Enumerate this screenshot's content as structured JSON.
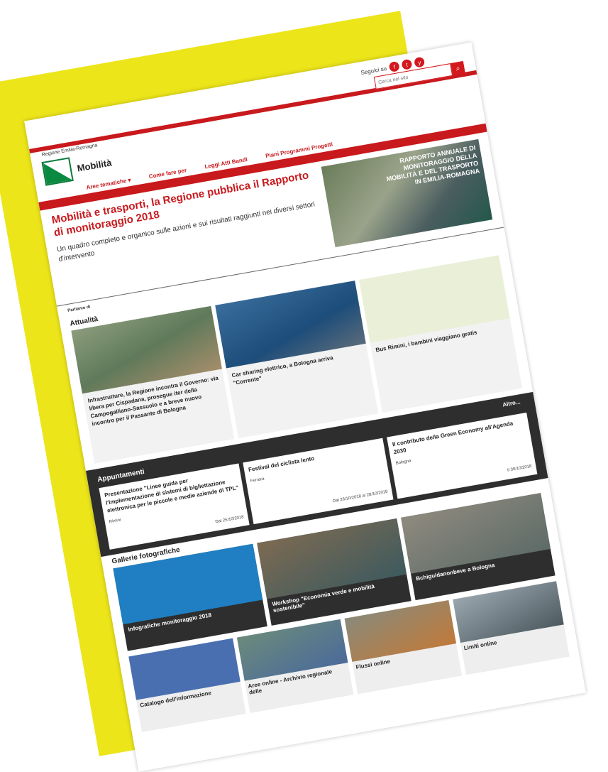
{
  "header": {
    "follow_label": "Seguici su",
    "social": [
      "f",
      "t",
      "y"
    ],
    "search_placeholder": "Cerca nel sito",
    "region": "Regione Emilia-Romagna",
    "brand": "Mobilità"
  },
  "nav": [
    "Aree tematiche ▾",
    "Come fare per",
    "Leggi Atti Bandi",
    "Piani Programmi Progetti"
  ],
  "hero": {
    "title": "Mobilità e trasporti, la Regione pubblica il Rapporto di monitoraggio 2018",
    "subtitle": "Un quadro completo e organico sulle azioni e sui risultati raggiunti nei diversi settori d'intervento",
    "image_caption": "RAPPORTO ANNUALE DI MONITORAGGIO DELLA MOBILITÀ E DEL TRASPORTO IN EMILIA-ROMAGNA"
  },
  "tags": {
    "label": "Parliamo di"
  },
  "attualita": {
    "title": "Attualità",
    "cards": [
      {
        "title": "Infrastrutture, la Regione incontra il Governo: via libera per Cispadana, prosegue iter della Campogalliano-Sassuolo e a breve nuovo incontro per il Passante di Bologna"
      },
      {
        "title": "Car sharing elettrico, a Bologna arriva \"Corrente\""
      },
      {
        "title": "Bus Rimini, i bambini viaggiano gratis"
      }
    ]
  },
  "appuntamenti": {
    "title": "Appuntamenti",
    "more": "Altro...",
    "events": [
      {
        "title": "Presentazione \"Linee guida per l'implementazione di sistemi di bigliettazione elettronica per le piccole e medie aziende di TPL\"",
        "where": "Rimini",
        "date": "Dal 25/10/2018"
      },
      {
        "title": "Festival del ciclista lento",
        "where": "Ferrara",
        "date": "Dal 26/10/2018 al 28/10/2018"
      },
      {
        "title": "Il contributo della Green Economy all'Agenda 2030",
        "where": "Bologna",
        "date": "Il 30/10/2018"
      }
    ]
  },
  "gallerie": {
    "title": "Gallerie fotografiche",
    "items": [
      {
        "title": "Infografiche monitoraggio 2018"
      },
      {
        "title": "Workshop \"Economia verde e mobilità sostenibile\""
      },
      {
        "title": "Bchiguidanonbeve a Bologna"
      }
    ]
  },
  "tiles": [
    {
      "title": "Catalogo dell'informazione"
    },
    {
      "title": "Aree online - Archivio regionale delle"
    },
    {
      "title": "Flussi online"
    },
    {
      "title": "Limiti online"
    }
  ]
}
